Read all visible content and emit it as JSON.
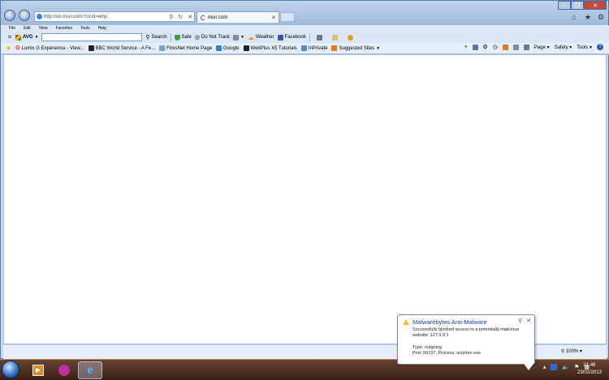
{
  "browser": {
    "address": "http://uk.msn.com/?ocid=iehp",
    "tab_title": "msn.com",
    "menu": [
      "File",
      "Edit",
      "View",
      "Favorites",
      "Tools",
      "Help"
    ]
  },
  "toolbar": {
    "avg_label": "AVG",
    "search_label": "Search",
    "safe_label": "Safe",
    "dnt_label": "Do Not Track",
    "weather_label": "Weather",
    "facebook_label": "Facebook"
  },
  "favorites": [
    {
      "label": "Lumix G Experience - View...",
      "icon": "g-icon",
      "color": "#d9241c"
    },
    {
      "label": "BBC World Service - A Fe...",
      "icon": "bbc-icon",
      "color": "#222222"
    },
    {
      "label": "FiresNet Home Page",
      "icon": "page-icon",
      "color": "#7aa0d0"
    },
    {
      "label": "Google",
      "icon": "google-icon",
      "color": "#3b7be0"
    },
    {
      "label": "WebPlus X5 Tutorials",
      "icon": "webplus-icon",
      "color": "#222222"
    },
    {
      "label": "InPrivate",
      "icon": "inprivate-icon",
      "color": "#4a8fd8"
    },
    {
      "label": "Suggested Sites",
      "icon": "suggested-icon",
      "color": "#e07a20"
    }
  ],
  "commandbar": {
    "page_label": "Page",
    "safety_label": "Safety",
    "tools_label": "Tools"
  },
  "status": {
    "zoom": "100%"
  },
  "notification": {
    "title": "Malwarebytes Anti-Malware",
    "line1": "Successfully blocked access to a potentially malicious",
    "line2": "website: 127.0.0.1",
    "line3": "Type: outgoing",
    "line4": "Port: 56197, Process: iexplore.exe"
  },
  "clock": {
    "time": "21:46",
    "date": "23/02/2013"
  }
}
